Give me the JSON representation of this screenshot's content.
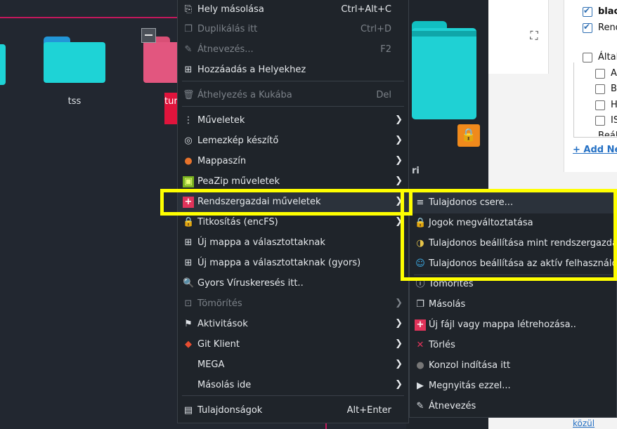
{
  "folders": [
    {
      "label": "tss",
      "color": "#1ed3d6",
      "tab": "#2296d7"
    },
    {
      "label": "tur",
      "color": "#e2567f",
      "tab": "#d94f76"
    }
  ],
  "info_panel": {
    "partial_text": "ri"
  },
  "web": {
    "checkboxes": [
      {
        "label": "black",
        "checked": true
      },
      {
        "label": "Rend",
        "checked": true
      },
      {
        "label": "Által",
        "checked": false
      },
      {
        "label": "A",
        "checked": false
      },
      {
        "label": "B",
        "checked": false
      },
      {
        "label": "H",
        "checked": false
      },
      {
        "label": "IS",
        "checked": false
      }
    ],
    "partial_item": "Beáll",
    "add_new_link": "+ Add New",
    "bottom_text": "közül"
  },
  "menu": {
    "items": [
      {
        "icon": "copy-location-icon",
        "glyph": "⎘",
        "label": "Hely másolása",
        "shortcut": "Ctrl+Alt+C"
      },
      {
        "icon": "duplicate-icon",
        "glyph": "❐",
        "label": "Duplikálás itt",
        "shortcut": "Ctrl+D",
        "disabled": true
      },
      {
        "icon": "rename-icon",
        "glyph": "✎",
        "label": "Átnevezés...",
        "shortcut": "F2",
        "disabled": true
      },
      {
        "icon": "bookmark-add-icon",
        "glyph": "⊞",
        "label": "Hozzáadás a Helyekhez"
      },
      {
        "icon": "trash-icon",
        "glyph": "🗑",
        "label": "Áthelyezés a Kukába",
        "shortcut": "Del",
        "disabled": true
      },
      {
        "icon": "more-actions-icon",
        "glyph": "⋮",
        "label": "Műveletek",
        "submenu": true
      },
      {
        "icon": "disk-image-icon",
        "glyph": "◎",
        "label": "Lemezkép készítő",
        "submenu": true
      },
      {
        "icon": "folder-color-icon",
        "glyph": "●",
        "label": "Mappaszín",
        "submenu": true
      },
      {
        "icon": "peazip-icon",
        "glyph": "▣",
        "label": "PeaZip műveletek",
        "submenu": true
      },
      {
        "icon": "admin-actions-icon",
        "glyph": "+",
        "label": "Rendszergazdai műveletek",
        "submenu": true,
        "highlighted": true
      },
      {
        "icon": "encrypt-lock-icon",
        "glyph": "🔒",
        "label": "Titkosítás (encFS)",
        "submenu": true
      },
      {
        "icon": "new-folder-icon",
        "glyph": "⊞",
        "label": "Új mappa a választottaknak"
      },
      {
        "icon": "new-folder-fast-icon",
        "glyph": "⊞",
        "label": "Új mappa a választottaknak (gyors)"
      },
      {
        "icon": "virus-scan-icon",
        "glyph": "🔍",
        "label": "Gyors Víruskeresés itt.."
      },
      {
        "icon": "compress-icon",
        "glyph": "⊡",
        "label": "Tömörítés",
        "submenu": true,
        "disabled": true
      },
      {
        "icon": "activities-icon",
        "glyph": "⚑",
        "label": "Aktivitások",
        "submenu": true
      },
      {
        "icon": "git-icon",
        "glyph": "◆",
        "label": "Git Klient",
        "submenu": true
      },
      {
        "icon": "mega-icon",
        "glyph": "",
        "label": "MEGA",
        "submenu": true
      },
      {
        "icon": "copy-here-icon",
        "glyph": "",
        "label": "Másolás ide",
        "submenu": true
      },
      {
        "icon": "properties-icon",
        "glyph": "▤",
        "label": "Tulajdonságok",
        "shortcut": "Alt+Enter"
      }
    ]
  },
  "submenu": {
    "items": [
      {
        "icon": "change-owner-icon",
        "glyph": "≡",
        "label": "Tulajdonos csere..."
      },
      {
        "icon": "permissions-lock-icon",
        "glyph": "🔒",
        "label": "Jogok megváltoztatása"
      },
      {
        "icon": "set-owner-root-icon",
        "glyph": "◑",
        "label": "Tulajdonos beállítása mint rendszergazda"
      },
      {
        "icon": "set-owner-user-icon",
        "glyph": "☺",
        "label": "Tulajdonos beállítása az aktív felhasználóra"
      },
      {
        "icon": "compress-icon",
        "glyph": "ⓘ",
        "label": "Tömörítés"
      },
      {
        "icon": "copy-icon",
        "glyph": "❐",
        "label": "Másolás"
      },
      {
        "icon": "new-file-folder-icon",
        "glyph": "+",
        "label": "Új fájl vagy mappa létrehozása.."
      },
      {
        "icon": "delete-icon",
        "glyph": "✕",
        "label": "Törlés"
      },
      {
        "icon": "terminal-icon",
        "glyph": "●",
        "label": "Konzol indítása itt"
      },
      {
        "icon": "open-with-icon",
        "glyph": "▶",
        "label": "Megnyitás ezzel..."
      },
      {
        "icon": "rename-icon",
        "glyph": "✎",
        "label": "Átnevezés"
      }
    ]
  },
  "colors": {
    "highlight_box": "#ffff00",
    "admin_icon": "#e0335a",
    "accent_line": "#c2185b"
  }
}
